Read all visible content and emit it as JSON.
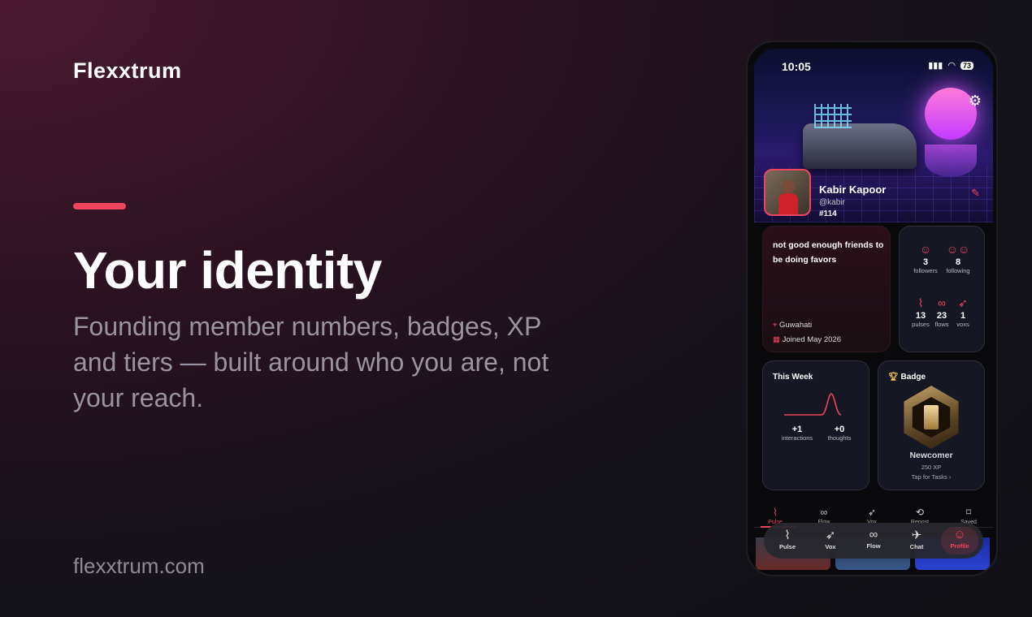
{
  "brand": "Flexxtrum",
  "headline": "Your identity",
  "subline": "Founding member numbers, badges, XP and tiers — built around who you are, not your reach.",
  "site": "flexxtrum.com",
  "colors": {
    "accent": "#f0455f",
    "bg": "#111116"
  },
  "phone": {
    "status": {
      "time": "10:05",
      "battery": "73"
    },
    "profile": {
      "name": "Kabir Kapoor",
      "handle": "@kabir",
      "member_no": "#114",
      "bio": "not good enough friends to be doing favors",
      "location": "Guwahati",
      "joined": "Joined May 2026"
    },
    "stats": {
      "followers": {
        "value": "3",
        "label": "followers",
        "icon": "user-icon"
      },
      "following": {
        "value": "8",
        "label": "following",
        "icon": "users-icon"
      },
      "pulses": {
        "value": "13",
        "label": "pulses",
        "icon": "pulse-icon"
      },
      "flows": {
        "value": "23",
        "label": "flows",
        "icon": "infinity-icon"
      },
      "voxs": {
        "value": "1",
        "label": "voxs",
        "icon": "bird-icon"
      }
    },
    "week": {
      "title": "This Week",
      "interactions": {
        "value": "+1",
        "label": "interactions"
      },
      "thoughts": {
        "value": "+0",
        "label": "thoughts"
      }
    },
    "badge": {
      "title": "Badge",
      "name": "Newcomer",
      "xp": "250 XP",
      "link": "Tap for Tasks"
    },
    "tabs": [
      "Pulse",
      "Flow",
      "Vox",
      "Repost",
      "Saved"
    ],
    "nav": [
      "Pulse",
      "Vox",
      "Flow",
      "Chat",
      "Profile"
    ]
  }
}
